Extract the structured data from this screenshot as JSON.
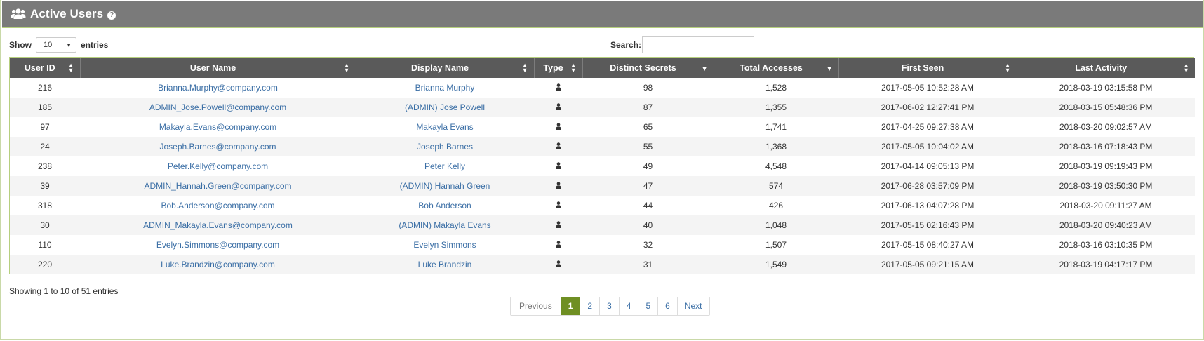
{
  "panel": {
    "title": "Active Users",
    "help_icon": "?"
  },
  "controls": {
    "show_label": "Show",
    "entries_label": "entries",
    "length_value": "10",
    "search_label": "Search:",
    "search_value": ""
  },
  "table": {
    "columns": [
      {
        "label": "User ID"
      },
      {
        "label": "User Name"
      },
      {
        "label": "Display Name"
      },
      {
        "label": "Type"
      },
      {
        "label": "Distinct Secrets"
      },
      {
        "label": "Total Accesses"
      },
      {
        "label": "First Seen"
      },
      {
        "label": "Last Activity"
      }
    ],
    "rows": [
      {
        "id": "216",
        "user": "Brianna.Murphy@company.com",
        "display": "Brianna Murphy",
        "type": "user-icon",
        "secrets": "98",
        "accesses": "1,528",
        "first": "2017-05-05 10:52:28 AM",
        "last": "2018-03-19 03:15:58 PM"
      },
      {
        "id": "185",
        "user": "ADMIN_Jose.Powell@company.com",
        "display": "(ADMIN) Jose Powell",
        "type": "user-icon",
        "secrets": "87",
        "accesses": "1,355",
        "first": "2017-06-02 12:27:41 PM",
        "last": "2018-03-15 05:48:36 PM"
      },
      {
        "id": "97",
        "user": "Makayla.Evans@company.com",
        "display": "Makayla Evans",
        "type": "user-icon",
        "secrets": "65",
        "accesses": "1,741",
        "first": "2017-04-25 09:27:38 AM",
        "last": "2018-03-20 09:02:57 AM"
      },
      {
        "id": "24",
        "user": "Joseph.Barnes@company.com",
        "display": "Joseph Barnes",
        "type": "user-icon",
        "secrets": "55",
        "accesses": "1,368",
        "first": "2017-05-05 10:04:02 AM",
        "last": "2018-03-16 07:18:43 PM"
      },
      {
        "id": "238",
        "user": "Peter.Kelly@company.com",
        "display": "Peter Kelly",
        "type": "user-icon",
        "secrets": "49",
        "accesses": "4,548",
        "first": "2017-04-14 09:05:13 PM",
        "last": "2018-03-19 09:19:43 PM"
      },
      {
        "id": "39",
        "user": "ADMIN_Hannah.Green@company.com",
        "display": "(ADMIN) Hannah Green",
        "type": "user-icon",
        "secrets": "47",
        "accesses": "574",
        "first": "2017-06-28 03:57:09 PM",
        "last": "2018-03-19 03:50:30 PM"
      },
      {
        "id": "318",
        "user": "Bob.Anderson@company.com",
        "display": "Bob Anderson",
        "type": "user-icon",
        "secrets": "44",
        "accesses": "426",
        "first": "2017-06-13 04:07:28 PM",
        "last": "2018-03-20 09:11:27 AM"
      },
      {
        "id": "30",
        "user": "ADMIN_Makayla.Evans@company.com",
        "display": "(ADMIN) Makayla Evans",
        "type": "user-icon",
        "secrets": "40",
        "accesses": "1,048",
        "first": "2017-05-15 02:16:43 PM",
        "last": "2018-03-20 09:40:23 AM"
      },
      {
        "id": "110",
        "user": "Evelyn.Simmons@company.com",
        "display": "Evelyn Simmons",
        "type": "user-icon",
        "secrets": "32",
        "accesses": "1,507",
        "first": "2017-05-15 08:40:27 AM",
        "last": "2018-03-16 03:10:35 PM"
      },
      {
        "id": "220",
        "user": "Luke.Brandzin@company.com",
        "display": "Luke Brandzin",
        "type": "user-icon",
        "secrets": "31",
        "accesses": "1,549",
        "first": "2017-05-05 09:21:15 AM",
        "last": "2018-03-19 04:17:17 PM"
      }
    ]
  },
  "footer": {
    "info": "Showing 1 to 10 of 51 entries",
    "pagination": {
      "previous": "Previous",
      "pages": [
        "1",
        "2",
        "3",
        "4",
        "5",
        "6"
      ],
      "active_page": "1",
      "next": "Next"
    }
  },
  "colors": {
    "header_bg": "#7a7a7a",
    "table_header_bg": "#5a5a5a",
    "accent_green": "#6f8f23",
    "border_green": "#b6cf7e",
    "link_blue": "#3a6ea5"
  }
}
